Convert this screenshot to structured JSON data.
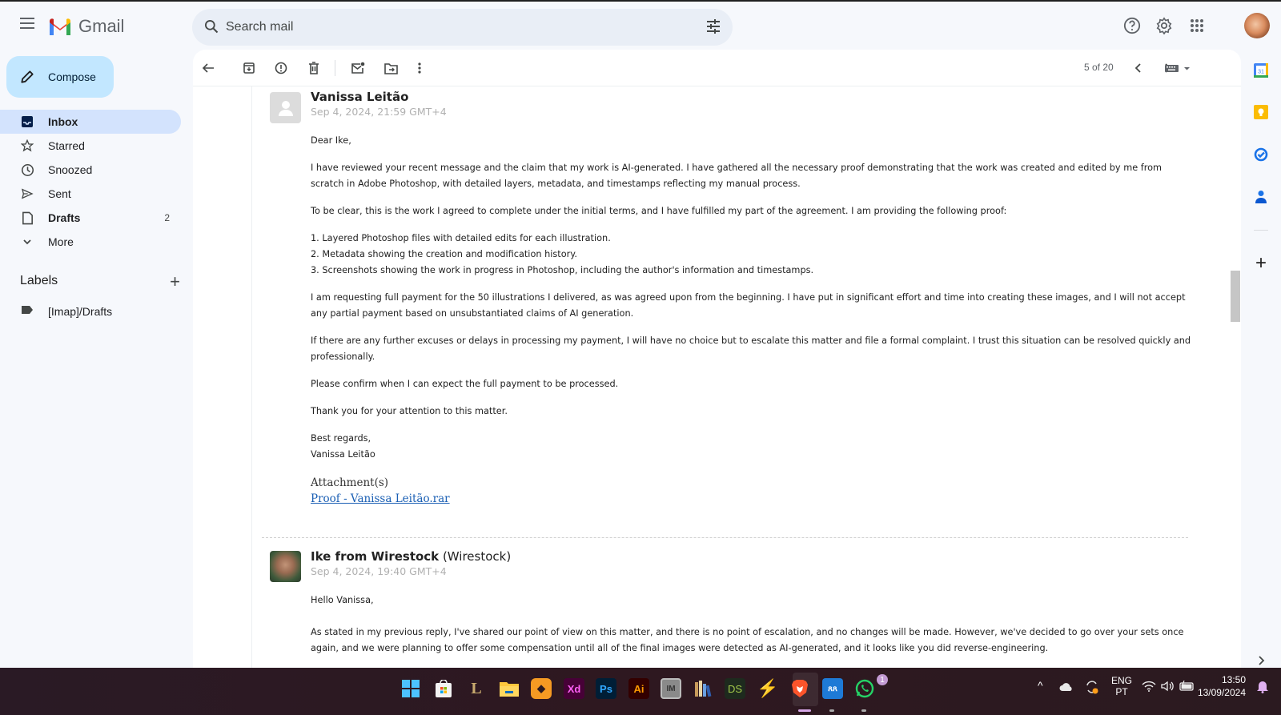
{
  "app": {
    "name": "Gmail"
  },
  "search": {
    "placeholder": "Search mail"
  },
  "compose": {
    "label": "Compose"
  },
  "nav": {
    "items": [
      {
        "label": "Inbox",
        "icon": "inbox-icon",
        "active": true
      },
      {
        "label": "Starred",
        "icon": "star-icon"
      },
      {
        "label": "Snoozed",
        "icon": "clock-icon"
      },
      {
        "label": "Sent",
        "icon": "send-icon"
      },
      {
        "label": "Drafts",
        "icon": "draft-icon",
        "count": "2"
      },
      {
        "label": "More",
        "icon": "chevron-down-icon"
      }
    ],
    "labels_heading": "Labels",
    "labels": [
      {
        "label": "[Imap]/Drafts",
        "icon": "label-icon"
      }
    ]
  },
  "toolbar": {
    "pager": "5 of 20",
    "buttons": [
      "back",
      "archive",
      "report-spam",
      "delete",
      "mark-unread",
      "move-to",
      "more"
    ]
  },
  "messages": [
    {
      "sender": "Vanissa Leitão",
      "org": "",
      "date": "Sep 4, 2024, 21:59 GMT+4",
      "greeting": "Dear Ike,",
      "p1": "I have reviewed your recent message and the claim that my work is AI-generated. I have gathered all the necessary proof demonstrating that the work was created and edited by me from scratch in Adobe Photoshop, with detailed layers, metadata, and timestamps reflecting my manual process.",
      "p2": "To be clear, this is the work I agreed to complete under the initial terms, and I have fulfilled my part of the agreement. I am providing the following proof:",
      "list": [
        "1. Layered Photoshop files with detailed edits for each illustration.",
        "2. Metadata showing the creation and modification history.",
        "3. Screenshots showing the work in progress in Photoshop, including the author's information and timestamps."
      ],
      "p3": "I am requesting full payment for the 50 illustrations I delivered, as was agreed upon from the beginning. I have put in significant effort and time into creating these images, and I will not accept any partial payment based on unsubstantiated claims of AI generation.",
      "p4": "If there are any further excuses or delays in processing my payment, I will have no choice but to escalate this matter and file a formal complaint. I trust this situation can be resolved quickly and professionally.",
      "p5": "Please confirm when I can expect the full payment to be processed.",
      "p6": "Thank you for your attention to this matter.",
      "signoff": "Best regards,",
      "signature": "Vanissa Leitão",
      "attachments_label": "Attachment(s)",
      "attachment": "Proof - Vanissa Leitão.rar"
    },
    {
      "sender": "Ike from Wirestock",
      "org": "(Wirestock)",
      "date": "Sep 4, 2024, 19:40 GMT+4",
      "greeting": "Hello Vanissa,",
      "p1": "As stated in my previous reply, I've shared our point of view on this matter, and there is no point of escalation, and no changes will be made. However, we've decided to go over your sets once again, and we were planning to offer some compensation until all of the final images were detected as AI-generated, and it looks like you did reverse-engineering."
    }
  ],
  "side_rail": [
    "calendar",
    "keep",
    "tasks",
    "contacts",
    "add"
  ],
  "taskbar": {
    "apps": [
      "Start",
      "Microsoft Store",
      "League of Legends",
      "File Explorer",
      "App",
      "Xd",
      "Ps",
      "Ai",
      "IM",
      "Library",
      "DS",
      "Flash",
      "Brave",
      "Teams",
      "WhatsApp"
    ],
    "whatsapp_badge": "1",
    "lang_top": "ENG",
    "lang_bottom": "PT",
    "time": "13:50",
    "date": "13/09/2024"
  }
}
